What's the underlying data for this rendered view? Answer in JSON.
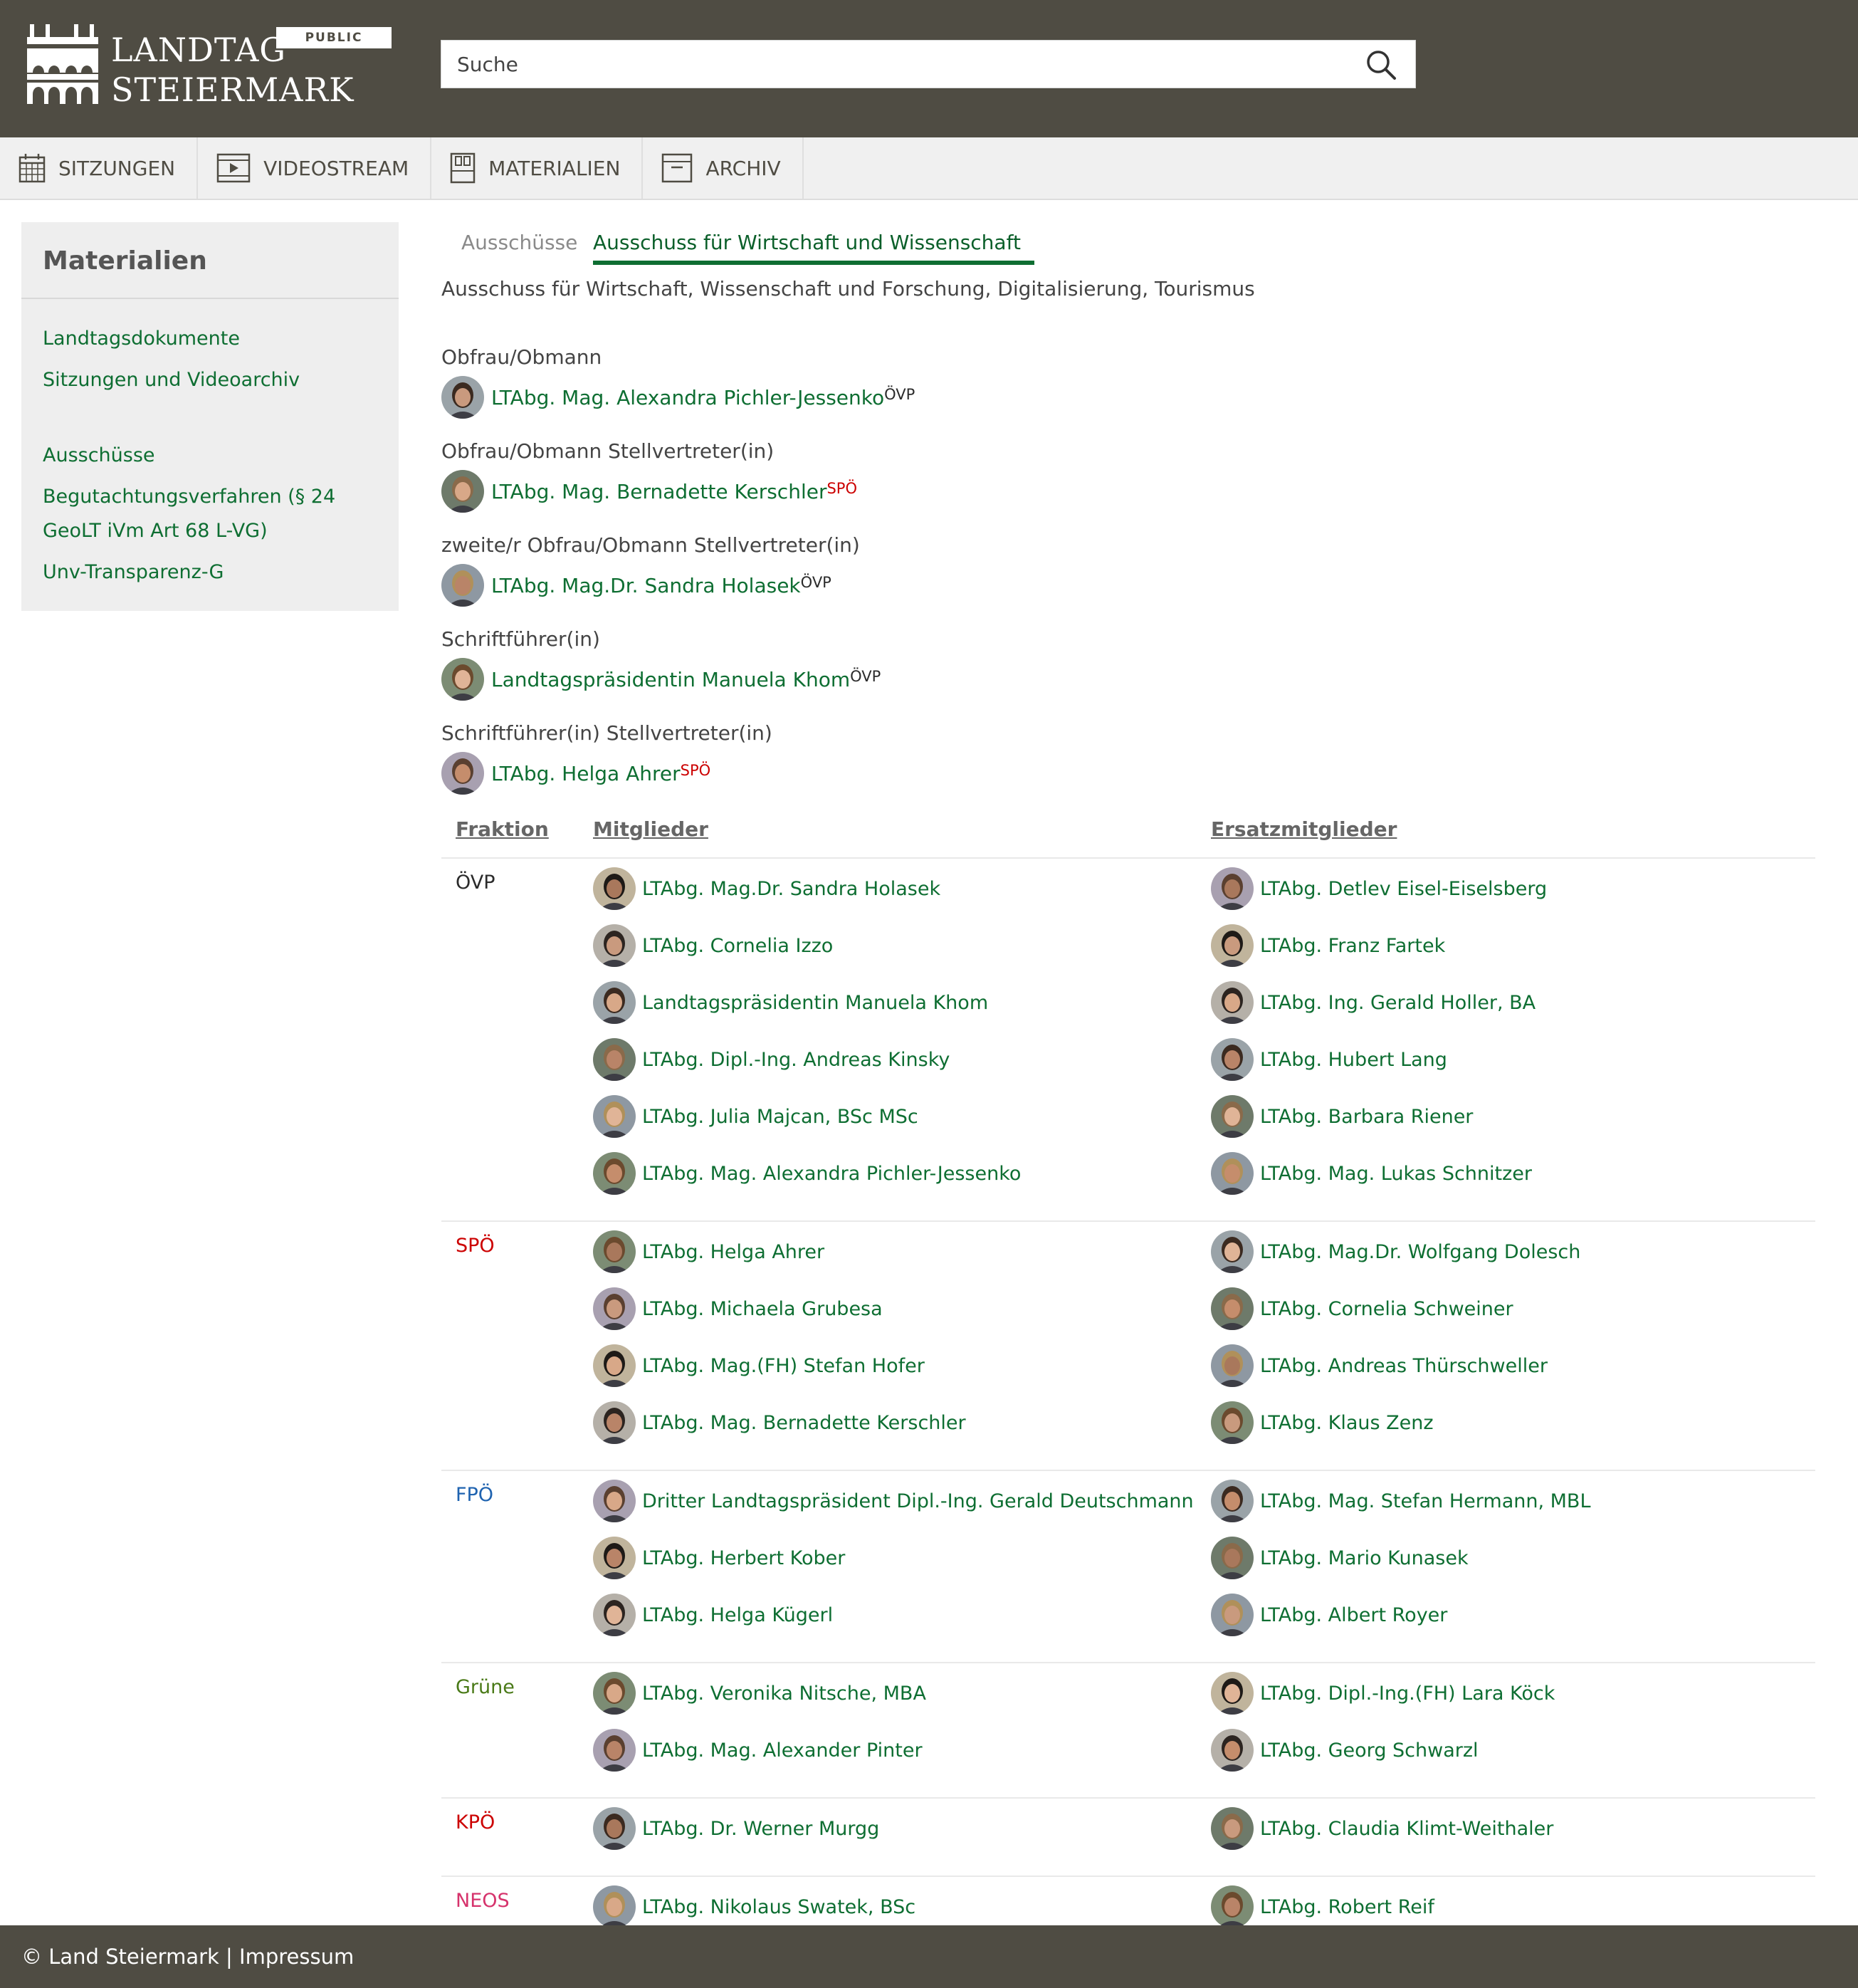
{
  "header": {
    "logo_line1": "LANDTAG",
    "logo_line2": "STEIERMARK",
    "badge": "PUBLIC",
    "search_placeholder": "Suche"
  },
  "nav": [
    {
      "label": "SITZUNGEN",
      "icon": "calendar-icon"
    },
    {
      "label": "VIDEOSTREAM",
      "icon": "video-icon"
    },
    {
      "label": "MATERIALIEN",
      "icon": "binder-icon"
    },
    {
      "label": "ARCHIV",
      "icon": "archive-box-icon"
    }
  ],
  "sidebar": {
    "title": "Materialien",
    "links": [
      "Landtagsdokumente",
      "Sitzungen und Videoarchiv",
      "Ausschüsse",
      "Begutachtungsverfahren (§ 24",
      "GeoLT iVm Art 68 L-VG)",
      "Unv-Transparenz-G"
    ]
  },
  "tabs": {
    "inactive": "Ausschüsse",
    "active": "Ausschuss für Wirtschaft und Wissenschaft"
  },
  "subtitle": "Ausschuss für Wirtschaft, Wissenschaft und Forschung, Digitalisierung, Tourismus",
  "roles": [
    {
      "label": "Obfrau/Obmann",
      "name": "LTAbg. Mag. Alexandra Pichler-Jessenko",
      "party": "ÖVP"
    },
    {
      "label": "Obfrau/Obmann Stellvertreter(in)",
      "name": "LTAbg. Mag. Bernadette Kerschler",
      "party": "SPÖ"
    },
    {
      "label": "zweite/r Obfrau/Obmann Stellvertreter(in)",
      "name": "LTAbg. Mag.Dr. Sandra Holasek",
      "party": "ÖVP"
    },
    {
      "label": "Schriftführer(in)",
      "name": "Landtagspräsidentin Manuela Khom",
      "party": "ÖVP"
    },
    {
      "label": "Schriftführer(in) Stellvertreter(in)",
      "name": "LTAbg. Helga Ahrer",
      "party": "SPÖ"
    }
  ],
  "table": {
    "headers": [
      "Fraktion",
      "Mitglieder",
      "Ersatzmitglieder"
    ],
    "groups": [
      {
        "party": "ÖVP",
        "color": "#2b2b2b",
        "members": [
          "LTAbg. Mag.Dr. Sandra Holasek",
          "LTAbg. Cornelia Izzo",
          "Landtagspräsidentin Manuela Khom",
          "LTAbg. Dipl.-Ing. Andreas Kinsky",
          "LTAbg. Julia Majcan, BSc MSc",
          "LTAbg. Mag. Alexandra Pichler-Jessenko"
        ],
        "substitutes": [
          "LTAbg. Detlev Eisel-Eiselsberg",
          "LTAbg. Franz Fartek",
          "LTAbg. Ing. Gerald Holler, BA",
          "LTAbg. Hubert Lang",
          "LTAbg. Barbara Riener",
          "LTAbg. Mag. Lukas Schnitzer"
        ]
      },
      {
        "party": "SPÖ",
        "color": "#cc0000",
        "members": [
          "LTAbg. Helga Ahrer",
          "LTAbg. Michaela Grubesa",
          "LTAbg. Mag.(FH) Stefan Hofer",
          "LTAbg. Mag. Bernadette Kerschler"
        ],
        "substitutes": [
          "LTAbg. Mag.Dr. Wolfgang Dolesch",
          "LTAbg. Cornelia Schweiner",
          "LTAbg. Andreas Thürschweller",
          "LTAbg. Klaus Zenz"
        ]
      },
      {
        "party": "FPÖ",
        "color": "#1f63b0",
        "members": [
          "Dritter Landtagspräsident Dipl.-Ing. Gerald Deutschmann",
          "LTAbg. Herbert Kober",
          "LTAbg. Helga Kügerl"
        ],
        "substitutes": [
          "LTAbg. Mag. Stefan Hermann, MBL",
          "LTAbg. Mario Kunasek",
          "LTAbg. Albert Royer"
        ]
      },
      {
        "party": "Grüne",
        "color": "#4a7a18",
        "members": [
          "LTAbg. Veronika Nitsche, MBA",
          "LTAbg. Mag. Alexander Pinter"
        ],
        "substitutes": [
          "LTAbg. Dipl.-Ing.(FH) Lara Köck",
          "LTAbg. Georg Schwarzl"
        ]
      },
      {
        "party": "KPÖ",
        "color": "#cc0000",
        "members": [
          "LTAbg. Dr. Werner Murgg"
        ],
        "substitutes": [
          "LTAbg. Claudia Klimt-Weithaler"
        ]
      },
      {
        "party": "NEOS",
        "color": "#d6336c",
        "members": [
          "LTAbg. Nikolaus Swatek, BSc"
        ],
        "substitutes": [
          "LTAbg. Robert Reif"
        ]
      }
    ]
  },
  "footer": {
    "copyright": "© Land Steiermark",
    "separator": "|",
    "impressum": "Impressum"
  },
  "colors": {
    "header_bg": "#4f4c43",
    "link_green": "#0e6e32",
    "nav_bg": "#f0f0f0",
    "sidebar_bg": "#eeeeee"
  }
}
